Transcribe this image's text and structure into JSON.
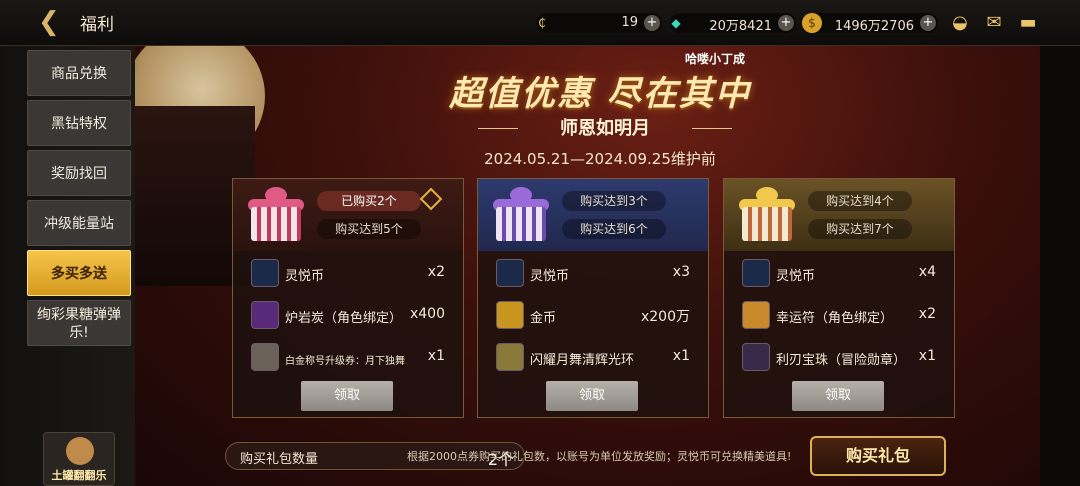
{
  "header": {
    "back_icon": "back-arrow-icon",
    "title": "福利",
    "currencies": [
      {
        "icon": "c-coin-icon",
        "value": "19"
      },
      {
        "icon": "green-crystal-icon",
        "value": "20万8421"
      },
      {
        "icon": "gold-coin-icon",
        "value": "1496万2706"
      }
    ],
    "icons": [
      "treasure-bag-icon",
      "mail-icon",
      "chat-icon"
    ]
  },
  "sidebar": {
    "items": [
      "商品兑换",
      "黑钻特权",
      "奖励找回",
      "冲级能量站",
      "多买多送",
      "绚彩果糖弹弹乐!"
    ],
    "active": "多买多送",
    "mini_label": "土罐翻翻乐"
  },
  "banner": {
    "author": "哈喽小丁成",
    "headline": "超值优惠 尽在其中",
    "subtitle": "师恩如明月",
    "dates": "2024.05.21—2024.09.25维护前"
  },
  "cards": [
    {
      "pill1": "已购买2个",
      "pill2": "购买达到5个",
      "rows": [
        {
          "icon": "coin-icon",
          "name": "灵悦币",
          "qty": "x2"
        },
        {
          "icon": "purple-gem-icon",
          "name": "炉岩炭（角色绑定）",
          "qty": "x400"
        },
        {
          "icon": "voucher-icon",
          "name": "白金称号升级券：月下独舞",
          "qty": "x1"
        }
      ],
      "button": "领取"
    },
    {
      "pill1": "购买达到3个",
      "pill2": "购买达到6个",
      "rows": [
        {
          "icon": "coin-icon",
          "name": "灵悦币",
          "qty": "x3"
        },
        {
          "icon": "gold-bars-icon",
          "name": "金币",
          "qty": "x200万"
        },
        {
          "icon": "halo-icon",
          "name": "闪耀月舞清辉光环",
          "qty": "x1"
        }
      ],
      "button": "领取"
    },
    {
      "pill1": "购买达到4个",
      "pill2": "购买达到7个",
      "rows": [
        {
          "icon": "coin-icon",
          "name": "灵悦币",
          "qty": "x4"
        },
        {
          "icon": "lucky-charm-icon",
          "name": "幸运符（角色绑定）",
          "qty": "x2"
        },
        {
          "icon": "gem-icon",
          "name": "利刃宝珠（冒险勋章）",
          "qty": "x1"
        }
      ],
      "button": "领取"
    }
  ],
  "footer": {
    "count_label": "购买礼包数量",
    "count_value": "2个",
    "note": "根据2000点券购买的礼包数，以账号为单位发放奖励；灵悦币可兑换精美道具!",
    "buy_label": "购买礼包"
  }
}
